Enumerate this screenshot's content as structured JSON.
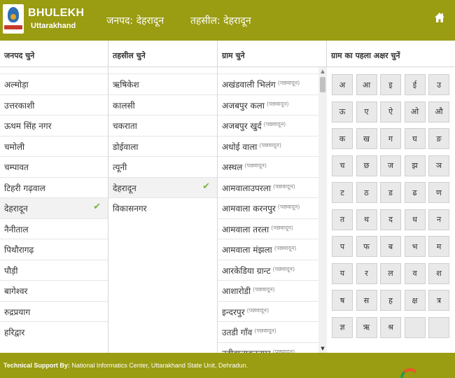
{
  "header": {
    "brand_title": "BHULEKH",
    "brand_subtitle": "Uttarakhand",
    "district_label": "जनपद: देहरादून",
    "tehsil_label": "तहसील: देहरादून",
    "bg_color": "#9a9c12"
  },
  "columns": {
    "district_header": "जनपद चुने",
    "tehsil_header": "तहसील चुने",
    "village_header": "ग्राम चुने",
    "letter_header": "ग्राम का पहला अक्षर चुनें"
  },
  "districts": [
    "अल्मोड़ा",
    "उत्तरकाशी",
    "ऊधम सिंह नगर",
    "चमोली",
    "चम्पावत",
    "टिहरी गढ़वाल",
    "देहरादून",
    "नैनीताल",
    "पिथौरागढ़",
    "पौड़ी",
    "बागेश्वर",
    "रुद्रप्रयाग",
    "हरिद्वार"
  ],
  "selected_district_index": 6,
  "tehsils": [
    "ऋषिकेश",
    "कालसी",
    "चकराता",
    "डोईवाला",
    "त्यूनी",
    "देहरादून",
    "विकासनगर"
  ],
  "selected_tehsil_index": 5,
  "villages": [
    {
      "name": "अखंडवाली भिलंग",
      "district": "(पछवादून)"
    },
    {
      "name": "अजबपुर कला",
      "district": "(पछवादून)"
    },
    {
      "name": "अजबपुर खुर्द",
      "district": "(पछवादून)"
    },
    {
      "name": "अधोई वाला",
      "district": "(पछवादून)"
    },
    {
      "name": "अस्थल",
      "district": "(पछवादून)"
    },
    {
      "name": "आमवालाउपरला",
      "district": "(पछवादून)"
    },
    {
      "name": "आमवाला करनपुर",
      "district": "(पछवादून)"
    },
    {
      "name": "आमवाला तरला",
      "district": "(पछवादून)"
    },
    {
      "name": "आमवाला मंझला",
      "district": "(पछवादून)"
    },
    {
      "name": "आरकेडिया ग्रान्ट",
      "district": "(पछवादून)"
    },
    {
      "name": "आशारोडी",
      "district": "(पछवादून)"
    },
    {
      "name": "इन्दरपुर",
      "district": "(पछवादून)"
    },
    {
      "name": "उतडी गाँव",
      "district": "(पछवादून)"
    },
    {
      "name": "उदीवालाकरनपुर",
      "district": "(पछवादून)"
    }
  ],
  "letters": [
    "अ",
    "आ",
    "इ",
    "ई",
    "उ",
    "ऊ",
    "ए",
    "ऐ",
    "ओ",
    "औ",
    "क",
    "ख",
    "ग",
    "घ",
    "ङ",
    "च",
    "छ",
    "ज",
    "झ",
    "ञ",
    "ट",
    "ठ",
    "ड",
    "ढ",
    "ण",
    "त",
    "थ",
    "द",
    "ध",
    "न",
    "प",
    "फ",
    "ब",
    "भ",
    "म",
    "य",
    "र",
    "ल",
    "व",
    "श",
    "ष",
    "स",
    "ह",
    "क्ष",
    "त्र",
    "ज्ञ",
    "ऋ",
    "श्र",
    "",
    ""
  ],
  "footer": {
    "support_label": "Technical Support By:",
    "support_text": "National Informatics Center, Uttarakhand State Unit, Dehradun."
  },
  "check_mark": "✔",
  "icons": {
    "home": "home-icon",
    "check": "check-icon",
    "scroll_up": "▲",
    "scroll_down": "▼"
  }
}
